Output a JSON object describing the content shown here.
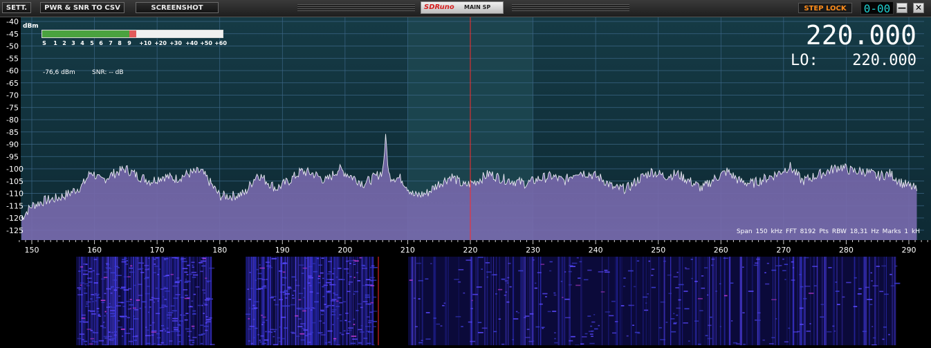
{
  "toolbar": {
    "sett_label": "SETT.",
    "pwr_snr_label": "PWR & SNR TO CSV",
    "screenshot_label": "SCREENSHOT",
    "brand_logo": "SDRuno",
    "window_title": "MAIN SP",
    "step_lock_label": "STEP LOCK",
    "tune_step_value": "0-00",
    "minimize_glyph": "—",
    "close_glyph": "✕"
  },
  "spectrum": {
    "y_axis_unit": "dBm",
    "y_ticks": [
      "-40",
      "-45",
      "-50",
      "-55",
      "-60",
      "-65",
      "-70",
      "-75",
      "-80",
      "-85",
      "-90",
      "-95",
      "-100",
      "-105",
      "-110",
      "-115",
      "-120",
      "-125"
    ],
    "x_ticks": [
      "150",
      "160",
      "170",
      "180",
      "190",
      "200",
      "210",
      "220",
      "230",
      "240",
      "250",
      "260",
      "270",
      "280",
      "290"
    ],
    "smeter_scale": [
      "S",
      "1",
      "2",
      "3",
      "4",
      "5",
      "6",
      "7",
      "8",
      "9",
      "+10",
      "+20",
      "+30",
      "+40",
      "+50",
      "+60"
    ],
    "smeter_level_fraction": 0.52,
    "power_readout": "-76,6 dBm",
    "snr_readout": "SNR: -- dB",
    "frequency_display": "220.000",
    "lo_label": "LO:",
    "lo_display": "220.000",
    "status_line": "Span 150 kHz  FFT 8192 Pts  RBW 18,31 Hz  Marks 1 kH",
    "colors": {
      "panel_bg": "#12343e",
      "filter_passband": "#1b3f48",
      "grid": "#3d6a8a",
      "trace_fill": "#6b5f9c",
      "trace_line": "#e8e8f0",
      "marker": "#ff2a2a"
    }
  },
  "chart_data": {
    "type": "area",
    "xlabel": "",
    "ylabel": "dBm",
    "xlim": [
      148,
      294
    ],
    "ylim": [
      -127,
      -38
    ],
    "center_frequency": 220,
    "passband": [
      210,
      230
    ],
    "x": [
      148,
      150,
      152,
      154,
      156,
      158,
      159.5,
      161,
      163,
      165,
      167,
      169,
      171,
      173,
      175,
      177,
      178,
      180,
      182,
      184,
      186,
      187,
      189,
      191,
      193,
      195,
      197,
      199,
      201,
      203,
      205,
      206,
      206.5,
      207,
      209,
      211,
      213,
      215,
      217,
      219,
      221,
      223,
      225,
      227,
      229,
      231,
      233,
      235,
      237,
      239,
      241,
      243,
      245,
      247,
      249,
      251,
      253,
      255,
      257,
      259,
      261,
      263,
      265,
      267,
      269,
      271,
      273,
      275,
      277,
      279,
      281,
      283,
      285,
      287,
      289,
      291,
      292,
      293
    ],
    "y": [
      -121,
      -115,
      -113,
      -112,
      -110,
      -107,
      -101,
      -105,
      -102,
      -100,
      -103,
      -105,
      -103,
      -104,
      -102,
      -101,
      -104,
      -111,
      -111,
      -110,
      -102,
      -104,
      -108,
      -105,
      -101,
      -102,
      -105,
      -100,
      -103,
      -106,
      -103,
      -101,
      -87,
      -103,
      -104,
      -111,
      -110,
      -106,
      -103,
      -107,
      -105,
      -102,
      -104,
      -105,
      -106,
      -104,
      -103,
      -105,
      -101,
      -102,
      -104,
      -108,
      -108,
      -104,
      -101,
      -103,
      -102,
      -105,
      -108,
      -104,
      -101,
      -105,
      -106,
      -104,
      -102,
      -99,
      -105,
      -103,
      -101,
      -99,
      -101,
      -101,
      -103,
      -102,
      -106,
      -108,
      -113,
      -122
    ]
  }
}
